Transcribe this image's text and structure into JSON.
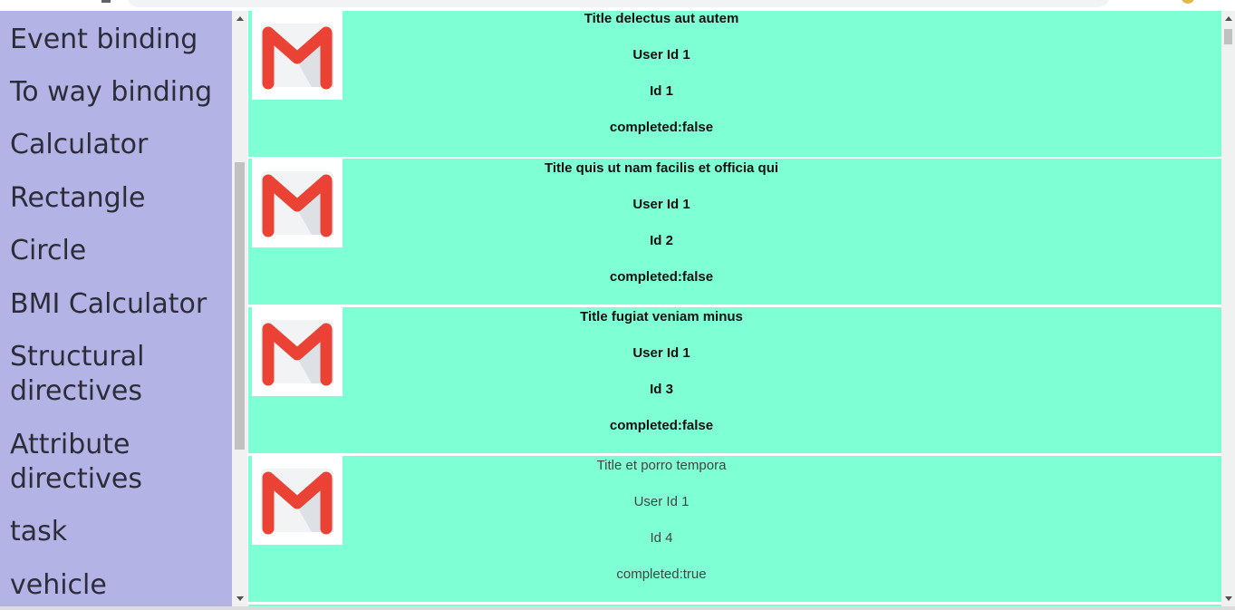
{
  "sidebar": {
    "items": [
      {
        "label": "Event binding"
      },
      {
        "label": "To way binding"
      },
      {
        "label": "Calculator"
      },
      {
        "label": "Rectangle"
      },
      {
        "label": "Circle"
      },
      {
        "label": "BMI Calculator"
      },
      {
        "label": "Structural directives"
      },
      {
        "label": "Attribute directives"
      },
      {
        "label": "task"
      },
      {
        "label": "vehicle"
      }
    ]
  },
  "todos": [
    {
      "icon": "gmail-icon",
      "title": "Title delectus aut autem",
      "user": "User Id 1",
      "id": "Id 1",
      "completed": "completed:false",
      "style": "bold"
    },
    {
      "icon": "gmail-icon",
      "title": "Title quis ut nam facilis et officia qui",
      "user": "User Id 1",
      "id": "Id 2",
      "completed": "completed:false",
      "style": "bold"
    },
    {
      "icon": "gmail-icon",
      "title": "Title fugiat veniam minus",
      "user": "User Id 1",
      "id": "Id 3",
      "completed": "completed:false",
      "style": "bold"
    },
    {
      "icon": "gmail-icon",
      "title": "Title et porro tempora",
      "user": "User Id 1",
      "id": "Id 4",
      "completed": "completed:true",
      "style": "light"
    }
  ],
  "colors": {
    "sidebar_bg": "#b3b3e6",
    "card_bg": "#7fffd4",
    "gmail_red": "#ea4335",
    "gmail_envelope": "#f1f3f4"
  }
}
